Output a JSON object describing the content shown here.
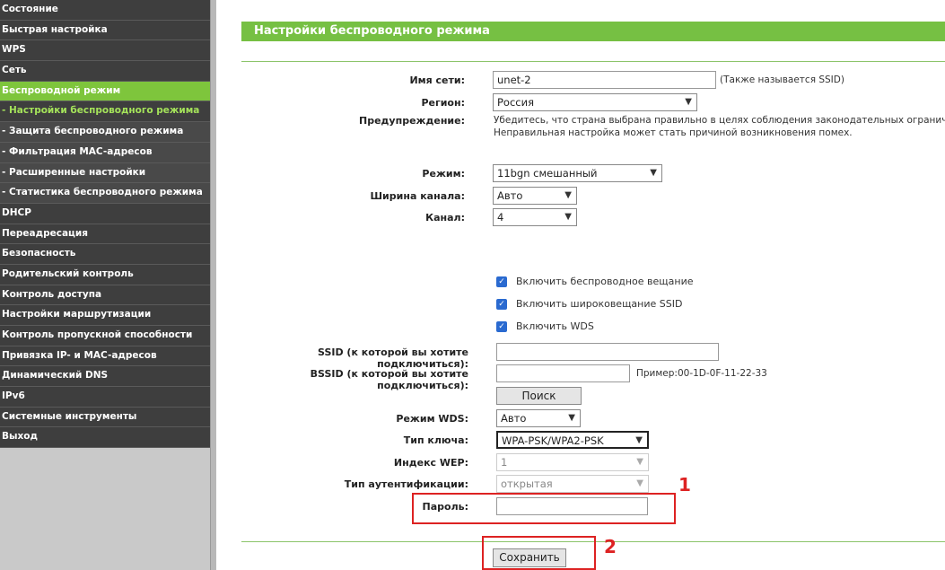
{
  "sidebar": {
    "items": [
      {
        "label": "Состояние"
      },
      {
        "label": "Быстрая настройка"
      },
      {
        "label": "WPS"
      },
      {
        "label": "Сеть"
      },
      {
        "label": "Беспроводной режим"
      },
      {
        "label": "- Настройки беспроводного режима"
      },
      {
        "label": "- Защита беспроводного режима"
      },
      {
        "label": "- Фильтрация MAC-адресов"
      },
      {
        "label": "- Расширенные настройки"
      },
      {
        "label": "- Статистика беспроводного режима"
      },
      {
        "label": "DHCP"
      },
      {
        "label": "Переадресация"
      },
      {
        "label": "Безопасность"
      },
      {
        "label": "Родительский контроль"
      },
      {
        "label": "Контроль доступа"
      },
      {
        "label": "Настройки маршрутизации"
      },
      {
        "label": "Контроль пропускной способности"
      },
      {
        "label": "Привязка IP- и MAC-адресов"
      },
      {
        "label": "Динамический DNS"
      },
      {
        "label": "IPv6"
      },
      {
        "label": "Системные инструменты"
      },
      {
        "label": "Выход"
      }
    ]
  },
  "header": {
    "title": "Настройки беспроводного режима"
  },
  "form": {
    "ssid": {
      "label": "Имя сети:",
      "value": "unet-2",
      "note": "(Также называется SSID)"
    },
    "region": {
      "label": "Регион:",
      "value": "Россия"
    },
    "warning": {
      "label": "Предупреждение:",
      "line1": "Убедитесь, что страна выбрана правильно в целях соблюдения законодательных ограничений.",
      "line2": "Неправильная настройка может стать причиной возникновения помех."
    },
    "mode": {
      "label": "Режим:",
      "value": "11bgn смешанный"
    },
    "width": {
      "label": "Ширина канала:",
      "value": "Авто"
    },
    "channel": {
      "label": "Канал:",
      "value": "4"
    },
    "checks": [
      {
        "label": "Включить беспроводное вещание"
      },
      {
        "label": "Включить широковещание SSID"
      },
      {
        "label": "Включить WDS"
      }
    ],
    "wds_ssid": {
      "label": "SSID (к которой вы хотите подключиться):",
      "value": ""
    },
    "wds_bssid": {
      "label": "BSSID (к которой вы хотите подключиться):",
      "value": "",
      "example": "Пример:00-1D-0F-11-22-33"
    },
    "search_label": "Поиск",
    "wds_mode": {
      "label": "Режим WDS:",
      "value": "Авто"
    },
    "key_type": {
      "label": "Тип ключа:",
      "value": "WPA-PSK/WPA2-PSK"
    },
    "wep_index": {
      "label": "Индекс WEP:",
      "value": "1"
    },
    "auth_type": {
      "label": "Тип аутентификации:",
      "value": "открытая"
    },
    "password": {
      "label": "Пароль:",
      "value": ""
    },
    "save_label": "Сохранить"
  },
  "annotations": {
    "one": "1",
    "two": "2"
  },
  "colors": {
    "accent": "#76c043",
    "sidebar_bg": "#3e3e3e",
    "annotation": "#d22222",
    "checkbox": "#2a6ad0"
  }
}
